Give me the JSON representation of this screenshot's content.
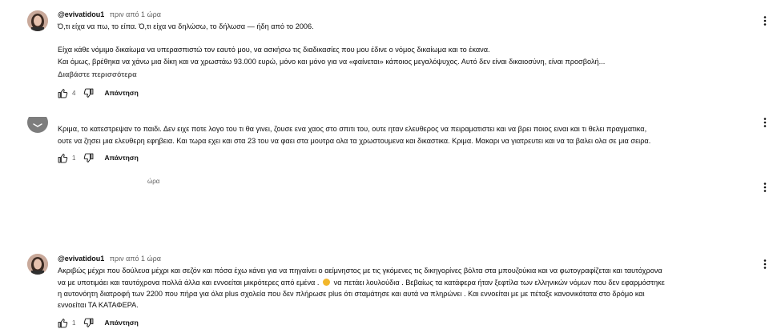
{
  "comments": [
    {
      "author": "@evivatidou1",
      "time": "πριν από 1 ώρα",
      "lines": [
        "Ό,τι είχα να πω, το είπα. Ό,τι είχα να δηλώσω, το δήλωσα — ήδη από το 2006.",
        "",
        "Είχα κάθε νόμιμο δικαίωμα να υπερασπιστώ τον εαυτό μου, να ασκήσω τις διαδικασίες που μου έδινε ο νόμος δικαίωμα και το έκανα.",
        "Και όμως, βρέθηκα να χάνω μια δίκη και να χρωστάω 93.000 ευρώ, μόνο και μόνο για να «φαίνεται» κάποιος μεγαλόψυχος. Αυτό δεν είναι δικαιοσύνη, είναι προσβολή..."
      ],
      "read_more": "Διαβάστε περισσότερα",
      "likes": "4",
      "reply": "Απάντηση"
    },
    {
      "lines": [
        "Κριμα, το κατεστρεψαν το παιδι. Δεν ειχε ποτε λογο του τι θα γινει, ζουσε ενα χαος στο σπιτι του, ουτε ηταν ελευθερος να πειραματιστει και να βρει ποιος ειναι και τι θελει πραγματικα,",
        "ουτε να ζησει μια ελευθερη εφηβεια. Και τωρα εχει και στα 23 του να φαει στα μουτρα ολα τα χρωστουμενα και δικαστικα. Κριμα. Μακαρι να γιατρευτει και να τα βαλει ολα σε μια σειρα."
      ],
      "likes": "1",
      "reply": "Απάντηση"
    },
    {
      "stray_time": "ώρα"
    },
    {
      "author": "@evivatidou1",
      "time": "πριν από 1 ώρα",
      "lines": [
        "Ακριβώς μέχρι που δούλευα μέχρι και σεζόν και πόσα έχω κάνει για να πηγαίνει ο αείμνηστος με τις γκόμενες τις δικηγορίνες βόλτα στα μπουζούκια και να φωτογραφίζεται και ταυτόχρονα",
        "να με υποτιμάει και ταυτόχρονα πολλά άλλα και εννοείται μικρότερες από εμένα .",
        "η αυτονόητη διατροφή των 2200 που πήρα για όλα plus σχολεία που δεν πλήρωσε plus ότι σταμάτησε και αυτά να πληρώνει . Και εννοείται με με πέταξε κανονικότατα στο δρόμο και",
        "εννοείται ΤΑ ΚΑΤΑΦΕΡΑ."
      ],
      "line2_suffix": " να πετάει λουλούδια . Βεβαίως τα κατάφερα ήταν ξεφτίλα των ελληνικών νόμων που δεν εφαρμόστηκε",
      "emoji": "surprised-face-emoji",
      "likes": "1",
      "reply": "Απάντηση"
    }
  ],
  "icons": {
    "like": "thumbs-up-icon",
    "dislike": "thumbs-down-icon",
    "menu": "vertical-ellipsis-icon"
  },
  "colors": {
    "text": "#0f0f0f",
    "secondary": "#606060",
    "background": "#ffffff"
  }
}
